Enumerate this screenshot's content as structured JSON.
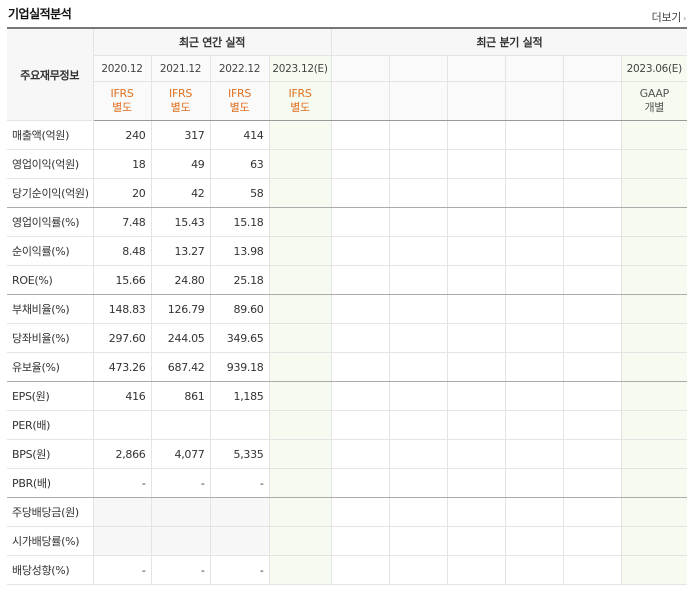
{
  "header": {
    "title": "기업실적분석",
    "more_label": "더보기",
    "more_arrow": "›"
  },
  "table": {
    "row_header_label": "주요재무정보",
    "annual_header": "최근 연간 실적",
    "quarter_header": "최근 분기 실적",
    "annual_periods": [
      "2020.12",
      "2021.12",
      "2022.12",
      "2023.12(E)"
    ],
    "annual_accounting": [
      {
        "std": "IFRS",
        "scope": "별도"
      },
      {
        "std": "IFRS",
        "scope": "별도"
      },
      {
        "std": "IFRS",
        "scope": "별도"
      },
      {
        "std": "IFRS",
        "scope": "별도"
      }
    ],
    "quarter_periods": [
      "",
      "",
      "",
      "",
      "",
      "2023.06(E)"
    ],
    "quarter_accounting": [
      {
        "std": "",
        "scope": ""
      },
      {
        "std": "",
        "scope": ""
      },
      {
        "std": "",
        "scope": ""
      },
      {
        "std": "",
        "scope": ""
      },
      {
        "std": "",
        "scope": ""
      },
      {
        "std": "GAAP",
        "scope": "개별"
      }
    ],
    "rows": [
      {
        "label": "매출액(억원)",
        "values": [
          "240",
          "317",
          "414"
        ]
      },
      {
        "label": "영업이익(억원)",
        "values": [
          "18",
          "49",
          "63"
        ]
      },
      {
        "label": "당기순이익(억원)",
        "values": [
          "20",
          "42",
          "58"
        ]
      },
      {
        "label": "영업이익률(%)",
        "values": [
          "7.48",
          "15.43",
          "15.18"
        ]
      },
      {
        "label": "순이익률(%)",
        "values": [
          "8.48",
          "13.27",
          "13.98"
        ]
      },
      {
        "label": "ROE(%)",
        "values": [
          "15.66",
          "24.80",
          "25.18"
        ]
      },
      {
        "label": "부채비율(%)",
        "values": [
          "148.83",
          "126.79",
          "89.60"
        ]
      },
      {
        "label": "당좌비율(%)",
        "values": [
          "297.60",
          "244.05",
          "349.65"
        ]
      },
      {
        "label": "유보율(%)",
        "values": [
          "473.26",
          "687.42",
          "939.18"
        ]
      },
      {
        "label": "EPS(원)",
        "values": [
          "416",
          "861",
          "1,185"
        ]
      },
      {
        "label": "PER(배)",
        "values": [
          "",
          "",
          ""
        ]
      },
      {
        "label": "BPS(원)",
        "values": [
          "2,866",
          "4,077",
          "5,335"
        ]
      },
      {
        "label": "PBR(배)",
        "values": [
          "-",
          "-",
          "-"
        ]
      },
      {
        "label": "주당배당금(원)",
        "values": [
          "",
          "",
          ""
        ]
      },
      {
        "label": "시가배당률(%)",
        "values": [
          "",
          "",
          ""
        ]
      },
      {
        "label": "배당성향(%)",
        "values": [
          "-",
          "-",
          "-"
        ]
      }
    ]
  },
  "colors": {
    "ifrs": "#e07020",
    "estimate_bg": "#f6fbf1",
    "empty_bg": "#f7f7f7"
  }
}
